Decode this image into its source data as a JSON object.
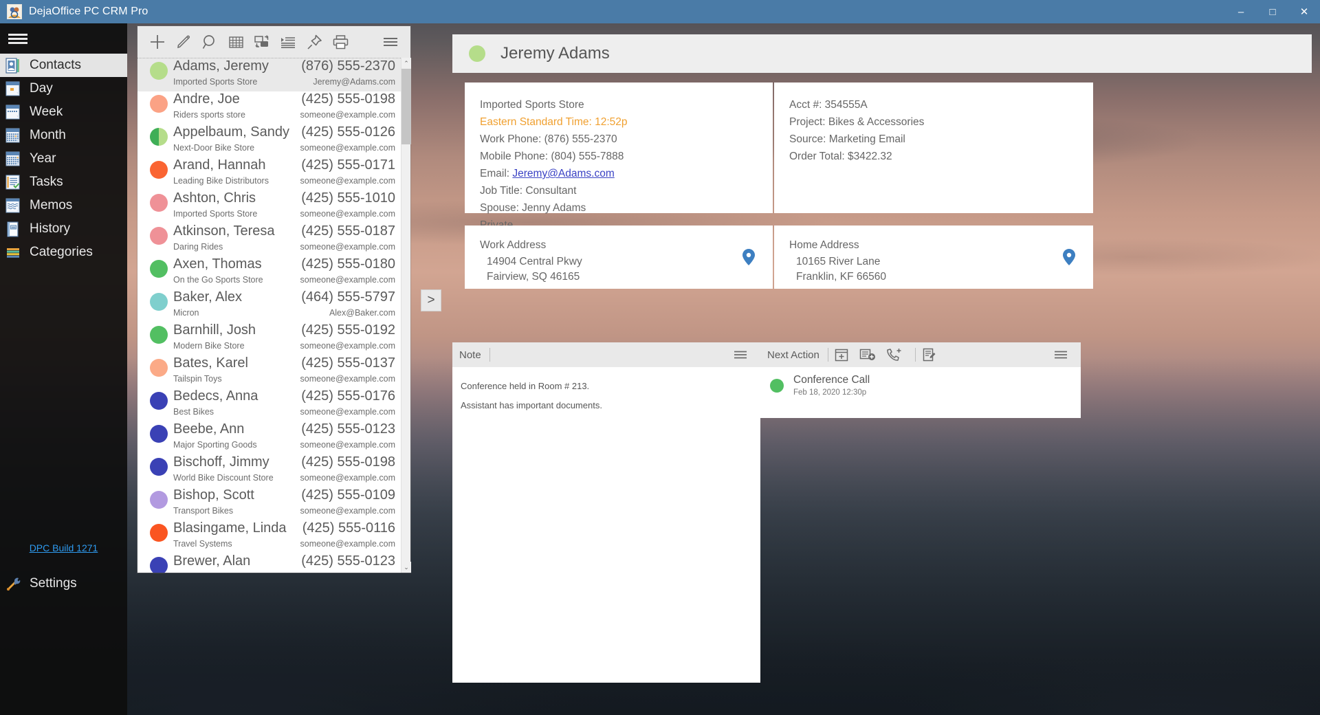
{
  "window": {
    "title": "DejaOffice PC CRM Pro",
    "titlebar_color": "#4a7ba7",
    "minimize": "–",
    "maximize": "□",
    "close": "✕"
  },
  "sidebar": {
    "menu_icon": "hamburger-icon",
    "items": [
      {
        "label": "Contacts",
        "icon": "contacts-icon",
        "selected": true
      },
      {
        "label": "Day",
        "icon": "day-icon",
        "selected": false
      },
      {
        "label": "Week",
        "icon": "week-icon",
        "selected": false
      },
      {
        "label": "Month",
        "icon": "month-icon",
        "selected": false
      },
      {
        "label": "Year",
        "icon": "year-icon",
        "selected": false
      },
      {
        "label": "Tasks",
        "icon": "tasks-icon",
        "selected": false
      },
      {
        "label": "Memos",
        "icon": "memos-icon",
        "selected": false
      },
      {
        "label": "History",
        "icon": "history-icon",
        "selected": false
      },
      {
        "label": "Categories",
        "icon": "categories-icon",
        "selected": false
      }
    ],
    "build_link": "DPC Build 1271",
    "settings_label": "Settings",
    "link_color": "#2e9bf0"
  },
  "list_toolbar": {
    "buttons": [
      {
        "name": "new-contact-button",
        "icon": "plus-icon"
      },
      {
        "name": "edit-contact-button",
        "icon": "pencil-icon"
      },
      {
        "name": "search-button",
        "icon": "search-icon"
      },
      {
        "name": "grid-view-button",
        "icon": "grid-icon"
      },
      {
        "name": "duplicate-button",
        "icon": "duplicate-icon"
      },
      {
        "name": "indent-list-button",
        "icon": "list-indent-icon"
      },
      {
        "name": "pin-button",
        "icon": "pin-icon"
      },
      {
        "name": "print-button",
        "icon": "printer-icon"
      }
    ],
    "menu": {
      "name": "list-menu-button",
      "icon": "hamburger-icon"
    }
  },
  "contact_list": {
    "rows": [
      {
        "name": "Adams, Jeremy",
        "phone": "(876) 555-2370",
        "company": "Imported Sports Store",
        "email": "Jeremy@Adams.com",
        "color": "#b5dd8a",
        "selected": true,
        "half": false
      },
      {
        "name": "Andre, Joe",
        "phone": "(425) 555-0198",
        "company": "Riders sports store",
        "email": "someone@example.com",
        "color": "#fba285",
        "selected": false,
        "half": false
      },
      {
        "name": "Appelbaum, Sandy",
        "phone": "(425) 555-0126",
        "company": "Next-Door Bike Store",
        "email": "someone@example.com",
        "color": "#b5dd8a",
        "selected": false,
        "half": true,
        "half_color": "#3fae56"
      },
      {
        "name": "Arand, Hannah",
        "phone": "(425) 555-0171",
        "company": "Leading Bike Distributors",
        "email": "someone@example.com",
        "color": "#fa6432",
        "selected": false,
        "half": false
      },
      {
        "name": "Ashton, Chris",
        "phone": "(425) 555-1010",
        "company": "Imported Sports Store",
        "email": "someone@example.com",
        "color": "#ef9197",
        "selected": false,
        "half": false
      },
      {
        "name": "Atkinson, Teresa",
        "phone": "(425) 555-0187",
        "company": "Daring Rides",
        "email": "someone@example.com",
        "color": "#ef9197",
        "selected": false,
        "half": false
      },
      {
        "name": "Axen, Thomas",
        "phone": "(425) 555-0180",
        "company": "On the Go Sports Store",
        "email": "someone@example.com",
        "color": "#52bf62",
        "selected": false,
        "half": false
      },
      {
        "name": "Baker, Alex",
        "phone": "(464) 555-5797",
        "company": "Micron",
        "email": "Alex@Baker.com",
        "color": "#7fcfcd",
        "selected": false,
        "half": false
      },
      {
        "name": "Barnhill, Josh",
        "phone": "(425) 555-0192",
        "company": "Modern Bike Store",
        "email": "someone@example.com",
        "color": "#52bf62",
        "selected": false,
        "half": false
      },
      {
        "name": "Bates, Karel",
        "phone": "(425) 555-0137",
        "company": "Tailspin Toys",
        "email": "someone@example.com",
        "color": "#fbaa87",
        "selected": false,
        "half": false
      },
      {
        "name": "Bedecs, Anna",
        "phone": "(425) 555-0176",
        "company": "Best Bikes",
        "email": "someone@example.com",
        "color": "#3a41b5",
        "selected": false,
        "half": false
      },
      {
        "name": "Beebe, Ann",
        "phone": "(425) 555-0123",
        "company": "Major Sporting Goods",
        "email": "someone@example.com",
        "color": "#3a41b5",
        "selected": false,
        "half": false
      },
      {
        "name": "Bischoff, Jimmy",
        "phone": "(425) 555-0198",
        "company": "World Bike Discount Store",
        "email": "someone@example.com",
        "color": "#3a41b5",
        "selected": false,
        "half": false
      },
      {
        "name": "Bishop, Scott",
        "phone": "(425) 555-0109",
        "company": "Transport Bikes",
        "email": "someone@example.com",
        "color": "#b29ae0",
        "selected": false,
        "half": false
      },
      {
        "name": "Blasingame, Linda",
        "phone": "(425) 555-0116",
        "company": "Travel Systems",
        "email": "someone@example.com",
        "color": "#fa5521",
        "selected": false,
        "half": false
      },
      {
        "name": "Brewer, Alan",
        "phone": "(425) 555-0123",
        "company": "",
        "email": "",
        "color": "#3a41b5",
        "selected": false,
        "half": false
      }
    ],
    "scroll_up": "⌃",
    "scroll_down": "⌄"
  },
  "expander": {
    "label": ">"
  },
  "detail": {
    "header": {
      "name": "Jeremy Adams",
      "dot_color": "#b5dd8a"
    },
    "info_card": {
      "company": "Imported Sports Store",
      "timezone": "Eastern Standard Time: 12:52p",
      "work_phone": "Work Phone: (876) 555-2370",
      "mobile_phone": "Mobile Phone: (804) 555-7888",
      "email_label": "Email: ",
      "email": "Jeremy@Adams.com",
      "job_title": "Job Title: Consultant",
      "spouse": "Spouse: Jenny Adams",
      "private": "Private",
      "accent_color": "#f0a030"
    },
    "acct_card": {
      "acct": "Acct #: 354555A",
      "project": "Project: Bikes & Accessories",
      "source": "Source: Marketing Email",
      "order_total": "Order Total: $3422.32"
    },
    "work_address": {
      "title": "Work Address",
      "line1": "14904 Central Pkwy",
      "line2": "Fairview, SQ 46165",
      "pin_icon": "map-pin-icon",
      "pin_color": "#3d7fc1"
    },
    "home_address": {
      "title": "Home Address",
      "line1": "10165 River Lane",
      "line2": "Franklin, KF 66560",
      "pin_icon": "map-pin-icon",
      "pin_color": "#3d7fc1"
    },
    "note_panel": {
      "title": "Note",
      "menu_icon": "hamburger-icon",
      "line1": "Conference held in Room # 213.",
      "line2": "Assistant has important documents."
    },
    "next_action_panel": {
      "title": "Next Action",
      "buttons": [
        {
          "name": "add-event-button",
          "icon": "calendar-add-icon"
        },
        {
          "name": "add-task-button",
          "icon": "task-add-icon"
        },
        {
          "name": "add-call-button",
          "icon": "call-add-icon"
        },
        {
          "name": "add-note-button",
          "icon": "note-add-icon"
        }
      ],
      "menu_icon": "hamburger-icon",
      "item": {
        "title": "Conference Call",
        "date": "Feb 18, 2020 12:30p",
        "dot_color": "#52bf62"
      }
    }
  }
}
